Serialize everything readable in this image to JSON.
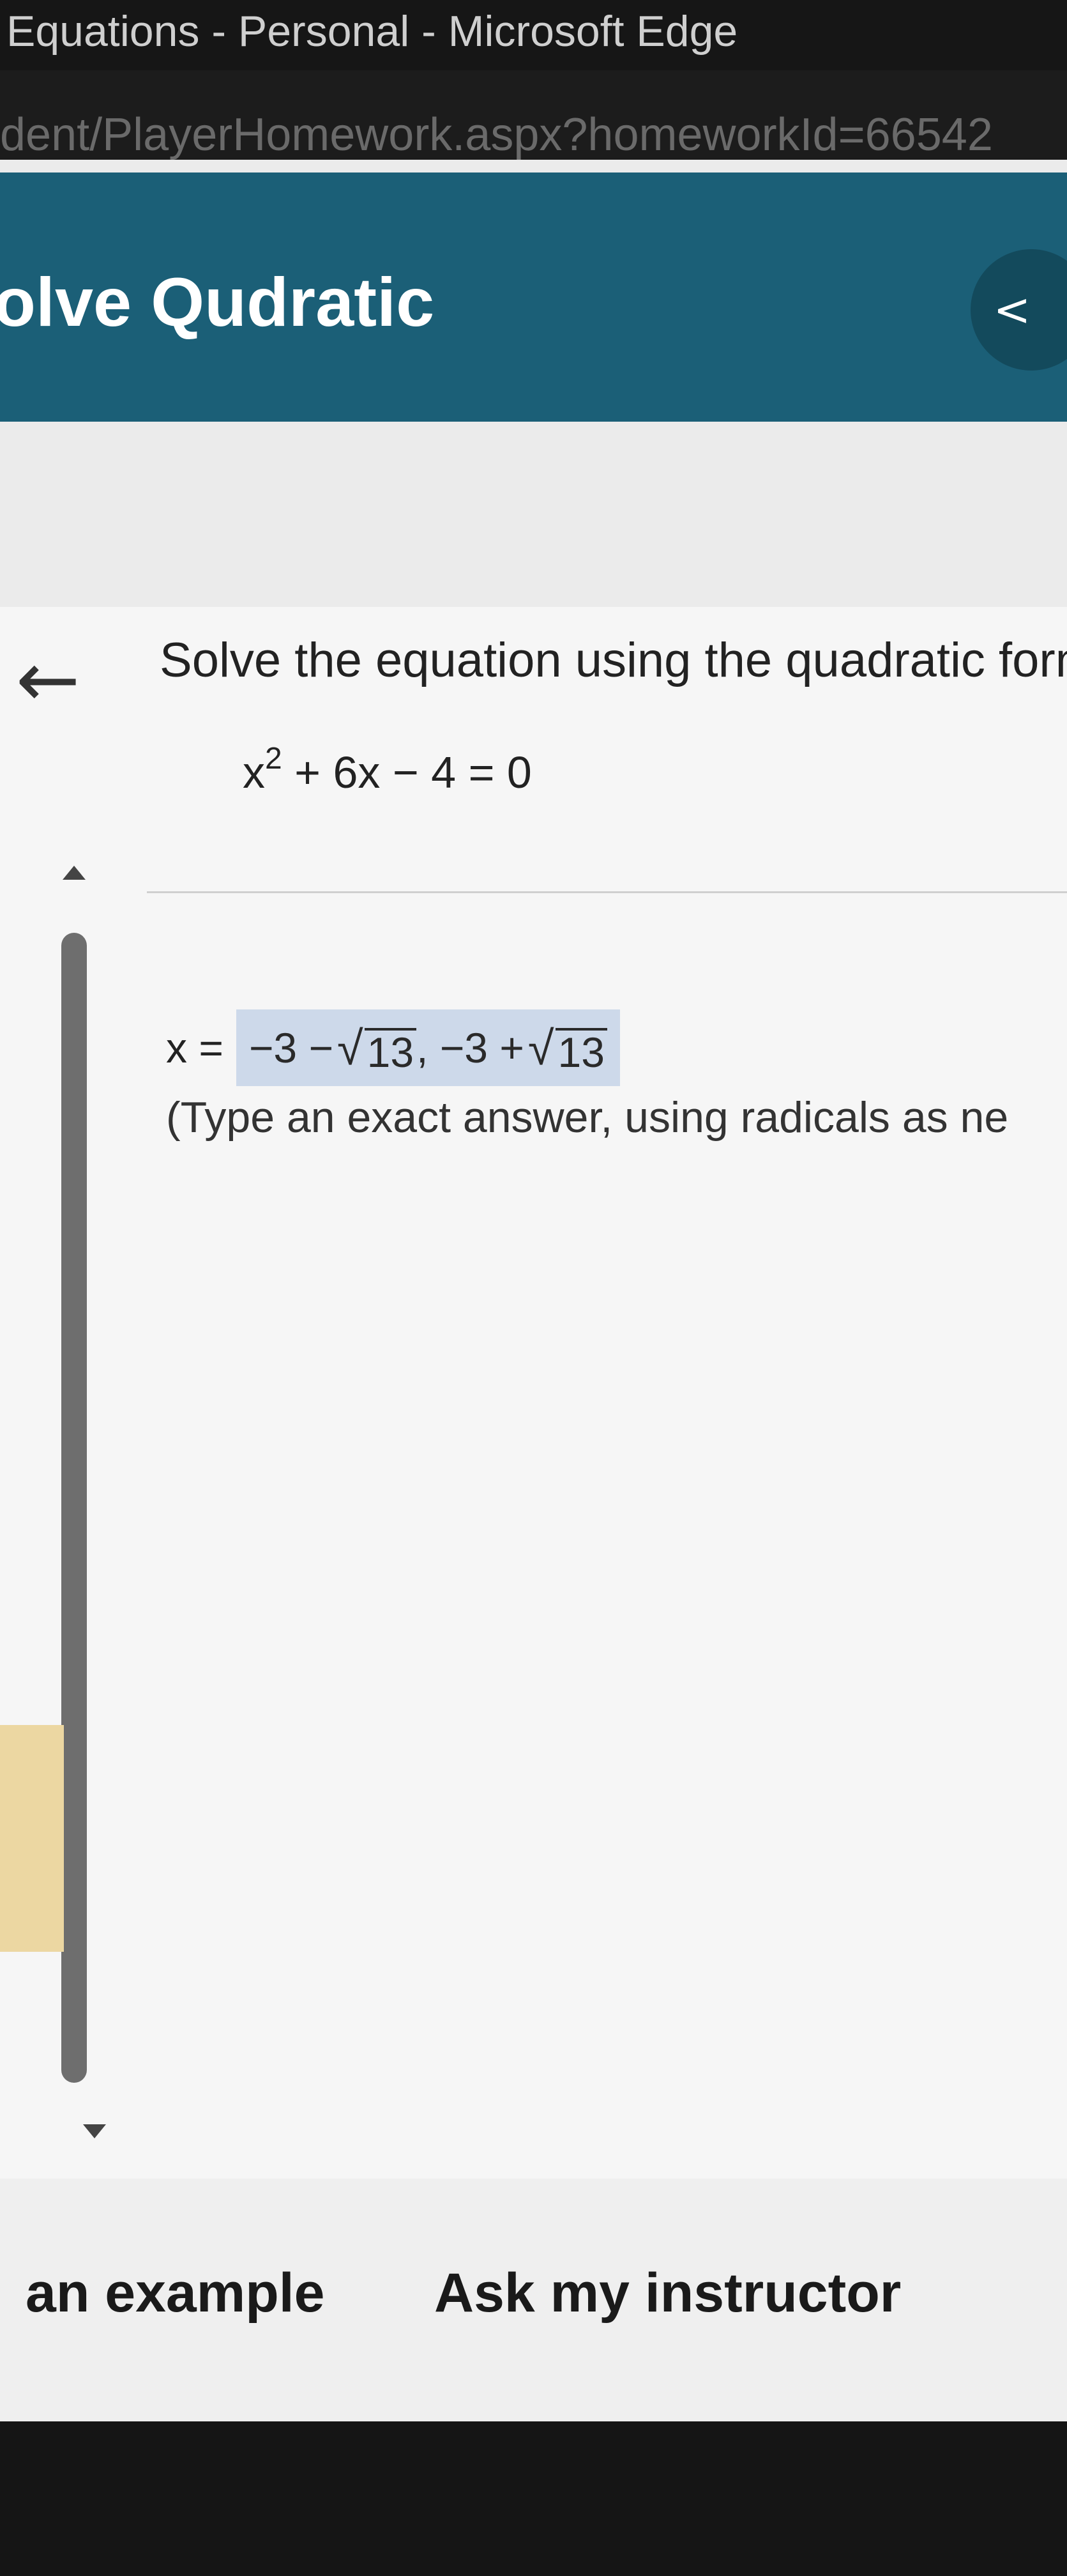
{
  "browser": {
    "title": "Equations - Personal - Microsoft Edge",
    "address": "dent/PlayerHomework.aspx?homeworkId=66542"
  },
  "banner": {
    "title": "olve Qudratic",
    "collapse_icon": "<"
  },
  "question": {
    "prompt": "Solve the equation using the quadratic form",
    "equation_base": "x",
    "equation_exp": "2",
    "equation_rest": " + 6x − 4 = 0"
  },
  "answer": {
    "label": "x =",
    "part1_prefix": "−3 −",
    "part1_radicand": "13",
    "separator": ", −3 +",
    "part2_radicand": "13",
    "hint": "(Type an exact answer, using radicals as ne"
  },
  "footer": {
    "example_label": "an example",
    "instructor_label": "Ask my instructor"
  },
  "colors": {
    "banner": "#1b5f77",
    "answer_highlight": "#cdd9ea",
    "side_tab": "#ecd7a2"
  }
}
